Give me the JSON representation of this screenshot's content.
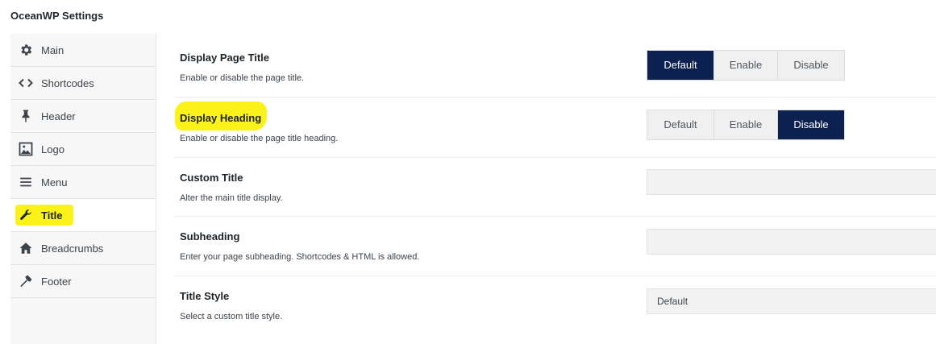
{
  "panel": {
    "title": "OceanWP Settings"
  },
  "sidebar": {
    "items": [
      {
        "label": "Main",
        "icon": "gear-icon"
      },
      {
        "label": "Shortcodes",
        "icon": "code-icon"
      },
      {
        "label": "Header",
        "icon": "pin-icon"
      },
      {
        "label": "Logo",
        "icon": "image-icon"
      },
      {
        "label": "Menu",
        "icon": "menu-icon"
      },
      {
        "label": "Title",
        "icon": "wrench-icon",
        "active": true
      },
      {
        "label": "Breadcrumbs",
        "icon": "home-icon"
      },
      {
        "label": "Footer",
        "icon": "hammer-icon"
      }
    ]
  },
  "settings": {
    "display_page_title": {
      "title": "Display Page Title",
      "desc": "Enable or disable the page title.",
      "options": [
        "Default",
        "Enable",
        "Disable"
      ],
      "selected": "Default"
    },
    "display_heading": {
      "title": "Display Heading",
      "desc": "Enable or disable the page title heading.",
      "options": [
        "Default",
        "Enable",
        "Disable"
      ],
      "selected": "Disable"
    },
    "custom_title": {
      "title": "Custom Title",
      "desc": "Alter the main title display.",
      "value": ""
    },
    "subheading": {
      "title": "Subheading",
      "desc": "Enter your page subheading. Shortcodes & HTML is allowed.",
      "value": ""
    },
    "title_style": {
      "title": "Title Style",
      "desc": "Select a custom title style.",
      "value": "Default"
    }
  },
  "colors": {
    "selected_segment": "#0d2150",
    "highlight": "#fbf21a"
  }
}
